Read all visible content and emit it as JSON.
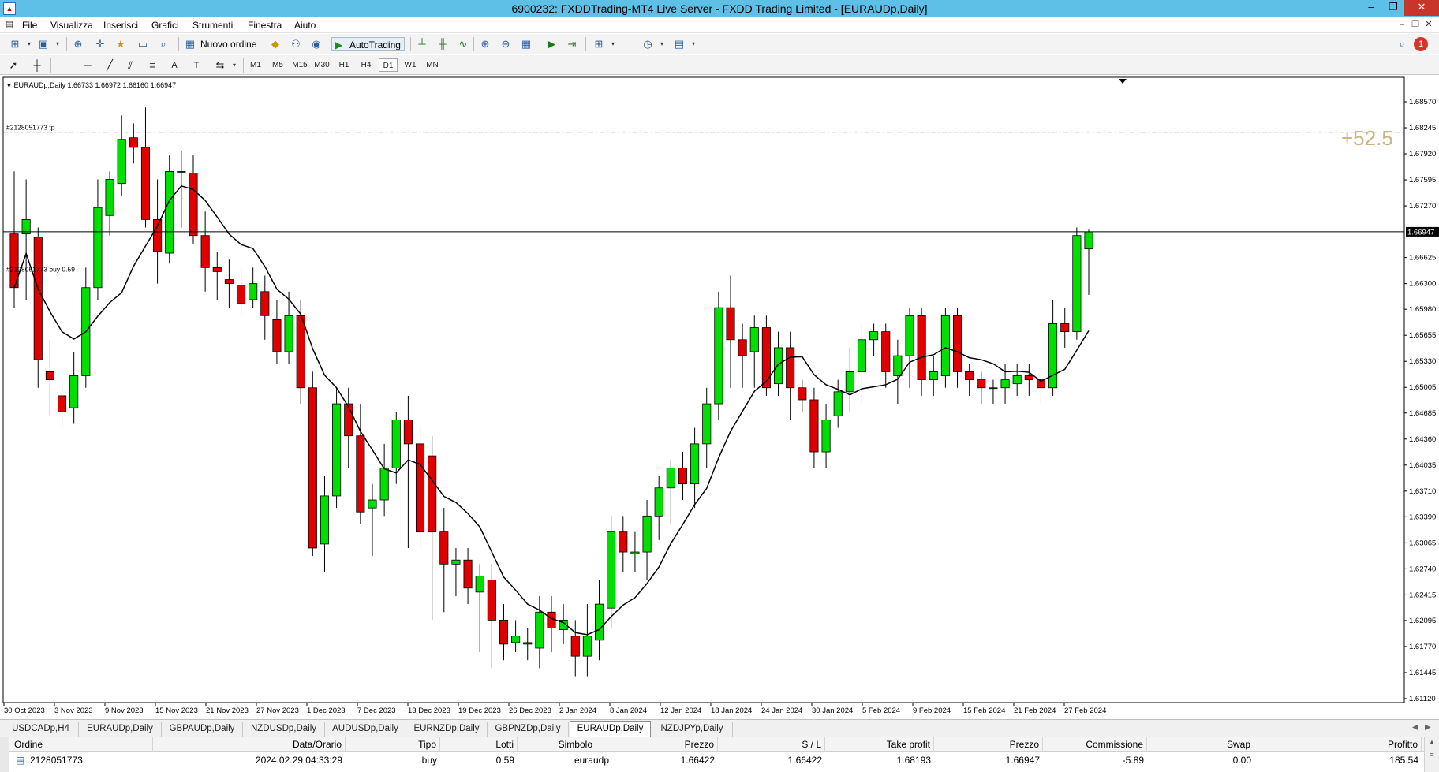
{
  "window": {
    "title": "6900232: FXDDTrading-MT4 Live Server - FXDD Trading Limited - [EURAUDp,Daily]",
    "minimize": "–",
    "restore": "❐",
    "close": "✕"
  },
  "menu": {
    "items": [
      "File",
      "Visualizza",
      "Inserisci",
      "Grafici",
      "Strumenti",
      "Finestra",
      "Aiuto"
    ],
    "alert_count": "1"
  },
  "toolbar": {
    "new_order_label": "Nuovo ordine",
    "autotrading_label": "AutoTrading",
    "timeframes": [
      "M1",
      "M5",
      "M15",
      "M30",
      "H1",
      "H4",
      "D1",
      "W1",
      "MN"
    ],
    "active_timeframe": "D1"
  },
  "chart": {
    "header": "EURAUDp,Daily  1.66733 1.66972 1.66160 1.66947",
    "tp_label": "#2128051773 tp",
    "order_label": "#2128051773 buy 0.59",
    "profit_points": "+52.5",
    "current_price_label": "1.66947",
    "price_labels": [
      "1.68570",
      "1.68245",
      "1.67920",
      "1.67595",
      "1.67270",
      "1.66947",
      "1.66625",
      "1.66300",
      "1.65980",
      "1.65655",
      "1.65330",
      "1.65005",
      "1.64685",
      "1.64360",
      "1.64035",
      "1.63710",
      "1.63390",
      "1.63065",
      "1.62740",
      "1.62415",
      "1.62095",
      "1.61770",
      "1.61445",
      "1.61120"
    ],
    "date_labels": [
      "30 Oct 2023",
      "3 Nov 2023",
      "9 Nov 2023",
      "15 Nov 2023",
      "21 Nov 2023",
      "27 Nov 2023",
      "1 Dec 2023",
      "7 Dec 2023",
      "13 Dec 2023",
      "19 Dec 2023",
      "26 Dec 2023",
      "2 Jan 2024",
      "8 Jan 2024",
      "12 Jan 2024",
      "18 Jan 2024",
      "24 Jan 2024",
      "30 Jan 2024",
      "5 Feb 2024",
      "9 Feb 2024",
      "15 Feb 2024",
      "21 Feb 2024",
      "27 Feb 2024"
    ],
    "colors": {
      "bull": "#00e000",
      "bear": "#e00000",
      "ma": "#000000",
      "level": "#e00000",
      "profit": "#c9b582"
    },
    "tp_price": 1.6819,
    "entry_price": 1.6642,
    "current_price": 1.66947
  },
  "chart_tabs": {
    "items": [
      "USDCADp,H4",
      "EURAUDp,Daily",
      "GBPAUDp,Daily",
      "NZDUSDp,Daily",
      "AUDUSDp,Daily",
      "EURNZDp,Daily",
      "GBPNZDp,Daily",
      "EURAUDp,Daily",
      "NZDJPYp,Daily"
    ],
    "active_index": 7
  },
  "terminal": {
    "columns": [
      "Ordine",
      "Data/Orario",
      "Tipo",
      "Lotti",
      "Simbolo",
      "Prezzo",
      "S / L",
      "Take profit",
      "Prezzo",
      "Commissione",
      "Swap",
      "Profitto"
    ],
    "row": {
      "order": "2128051773",
      "time": "2024.02.29 04:33:29",
      "type": "buy",
      "lots": "0.59",
      "symbol": "euraudp",
      "open_price": "1.66422",
      "sl": "1.66422",
      "tp": "1.68193",
      "price": "1.66947",
      "commission": "-5.89",
      "swap": "0.00",
      "profit": "185.54"
    }
  }
}
